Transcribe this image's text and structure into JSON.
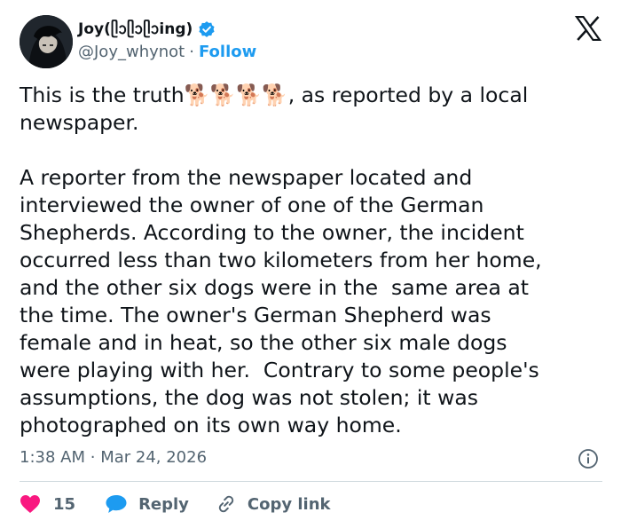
{
  "author": {
    "display_name": "Joy(ᥫᩣᥫᩣᥫᩣing)",
    "handle": "@Joy_whynot",
    "separator": "·",
    "follow_label": "Follow",
    "verified_color": "#1d9bf0"
  },
  "tweet": {
    "text": "This is the truth🐕🐕🐕🐕, as reported by a local\nnewspaper.\n\nA reporter from the newspaper located and\ninterviewed the owner of one of the German\nShepherds. According to the owner, the incident\noccurred less than two kilometers from her home,\nand the other six dogs were in the  same area at\nthe time. The owner's German Shepherd was\nfemale and in heat, so the other six male dogs\nwere playing with her.  Contrary to some people's\nassumptions, the dog was not stolen; it was\nphotographed on its own way home.",
    "time": "1:38 AM",
    "date": "Mar 24, 2026",
    "meta_separator": "·"
  },
  "actions": {
    "like_count": "15",
    "reply_label": "Reply",
    "copy_link_label": "Copy link"
  },
  "icons": {
    "verified": "verified-badge-icon",
    "platform": "x-logo-icon",
    "info": "info-icon",
    "like": "heart-icon",
    "reply": "speech-bubble-icon",
    "copy_link": "link-icon"
  },
  "colors": {
    "text": "#0f1419",
    "secondary": "#536471",
    "accent": "#1d9bf0",
    "like": "#f91880",
    "divider": "#cfd9de"
  }
}
